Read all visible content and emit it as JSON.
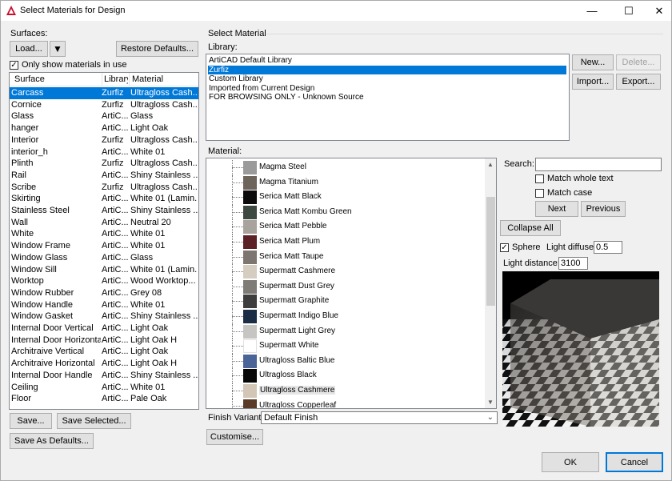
{
  "window": {
    "title": "Select Materials for Design",
    "minimize_glyph": "—",
    "maximize_glyph": "☐",
    "close_glyph": "✕"
  },
  "surfaces": {
    "label": "Surfaces:",
    "load_label": "Load...",
    "load_dropdown_glyph": "▼",
    "restore_label": "Restore Defaults...",
    "only_in_use_label": "Only show materials in use",
    "only_in_use_checked": true,
    "columns": [
      "Surface",
      "Library",
      "Material"
    ],
    "rows": [
      {
        "surface": "Carcass",
        "library": "Zurfiz",
        "material": "Ultragloss Cash...",
        "selected": true
      },
      {
        "surface": "Cornice",
        "library": "Zurfiz",
        "material": "Ultragloss Cash..."
      },
      {
        "surface": "Glass",
        "library": "ArtiC...",
        "material": "Glass"
      },
      {
        "surface": "hanger",
        "library": "ArtiC...",
        "material": "Light Oak"
      },
      {
        "surface": "Interior",
        "library": "Zurfiz",
        "material": "Ultragloss Cash..."
      },
      {
        "surface": "interior_h",
        "library": "ArtiC...",
        "material": "White 01"
      },
      {
        "surface": "Plinth",
        "library": "Zurfiz",
        "material": "Ultragloss Cash..."
      },
      {
        "surface": "Rail",
        "library": "ArtiC...",
        "material": "Shiny Stainless ..."
      },
      {
        "surface": "Scribe",
        "library": "Zurfiz",
        "material": "Ultragloss Cash..."
      },
      {
        "surface": "Skirting",
        "library": "ArtiC...",
        "material": "White 01 (Lamin..."
      },
      {
        "surface": "Stainless Steel",
        "library": "ArtiC...",
        "material": "Shiny Stainless ..."
      },
      {
        "surface": "Wall",
        "library": "ArtiC...",
        "material": "Neutral 20"
      },
      {
        "surface": "White",
        "library": "ArtiC...",
        "material": "White 01"
      },
      {
        "surface": "Window Frame",
        "library": "ArtiC...",
        "material": "White 01"
      },
      {
        "surface": "Window Glass",
        "library": "ArtiC...",
        "material": "Glass"
      },
      {
        "surface": "Window Sill",
        "library": "ArtiC...",
        "material": "White 01 (Lamin..."
      },
      {
        "surface": "Worktop",
        "library": "ArtiC...",
        "material": "Wood Worktop..."
      },
      {
        "surface": "Window Rubber",
        "library": "ArtiC...",
        "material": "Grey 08"
      },
      {
        "surface": "Window Handle",
        "library": "ArtiC...",
        "material": "White 01"
      },
      {
        "surface": "Window Gasket",
        "library": "ArtiC...",
        "material": "Shiny Stainless ..."
      },
      {
        "surface": "Internal Door Vertical",
        "library": "ArtiC...",
        "material": "Light Oak"
      },
      {
        "surface": "Internal Door Horizontal",
        "library": "ArtiC...",
        "material": "Light Oak H"
      },
      {
        "surface": "Architraive Vertical",
        "library": "ArtiC...",
        "material": "Light Oak"
      },
      {
        "surface": "Architraive Horizontal",
        "library": "ArtiC...",
        "material": "Light Oak H"
      },
      {
        "surface": "Internal Door Handle",
        "library": "ArtiC...",
        "material": "Shiny Stainless ..."
      },
      {
        "surface": "Ceiling",
        "library": "ArtiC...",
        "material": "White 01"
      },
      {
        "surface": "Floor",
        "library": "ArtiC...",
        "material": "Pale Oak"
      }
    ],
    "save_label": "Save...",
    "save_selected_label": "Save Selected...",
    "save_defaults_label": "Save As Defaults..."
  },
  "select_material": {
    "group_label": "Select Material",
    "library_label": "Library:",
    "libraries": [
      {
        "name": "ArtiCAD Default Library"
      },
      {
        "name": "Zurfiz",
        "selected": true
      },
      {
        "name": "Custom Library"
      },
      {
        "name": "Imported from Current Design"
      },
      {
        "name": "FOR BROWSING ONLY - Unknown Source"
      }
    ],
    "new_label": "New...",
    "delete_label": "Delete...",
    "import_label": "Import...",
    "export_label": "Export...",
    "material_label": "Material:",
    "materials": [
      {
        "name": "Magma Steel",
        "color": "#9a9a9a"
      },
      {
        "name": "Magma Titanium",
        "color": "#6d655c"
      },
      {
        "name": "Serica Matt Black",
        "color": "#0b0b0b"
      },
      {
        "name": "Serica Matt Kombu Green",
        "color": "#3d4840"
      },
      {
        "name": "Serica Matt Pebble",
        "color": "#a8a39c"
      },
      {
        "name": "Serica Matt Plum",
        "color": "#5c2027"
      },
      {
        "name": "Serica Matt Taupe",
        "color": "#7d7570"
      },
      {
        "name": "Supermatt Cashmere",
        "color": "#d6cdc1"
      },
      {
        "name": "Supermatt Dust Grey",
        "color": "#7f7b77"
      },
      {
        "name": "Supermatt Graphite",
        "color": "#3d3d3d"
      },
      {
        "name": "Supermatt Indigo Blue",
        "color": "#1a2d45"
      },
      {
        "name": "Supermatt Light Grey",
        "color": "#c7c5c2"
      },
      {
        "name": "Supermatt White",
        "color": "#ffffff"
      },
      {
        "name": "Ultragloss Baltic Blue",
        "color": "#4a6497"
      },
      {
        "name": "Ultragloss Black",
        "color": "#070707"
      },
      {
        "name": "Ultragloss Cashmere",
        "color": "#d3c6b6",
        "highlighted": true
      },
      {
        "name": "Ultragloss Copperleaf",
        "color": "#5a3a28"
      }
    ],
    "search_label": "Search:",
    "search_value": "",
    "match_whole_label": "Match whole text",
    "match_case_label": "Match case",
    "next_label": "Next",
    "previous_label": "Previous",
    "collapse_label": "Collapse All",
    "sphere_label": "Sphere",
    "sphere_checked": true,
    "light_diffuse_label": "Light diffuse:",
    "light_diffuse_value": "0.5",
    "light_distance_label": "Light distance:",
    "light_distance_value": "3100",
    "finish_variant_label": "Finish Variant",
    "finish_variant_value": "Default Finish",
    "customise_label": "Customise..."
  },
  "footer": {
    "ok_label": "OK",
    "cancel_label": "Cancel"
  }
}
